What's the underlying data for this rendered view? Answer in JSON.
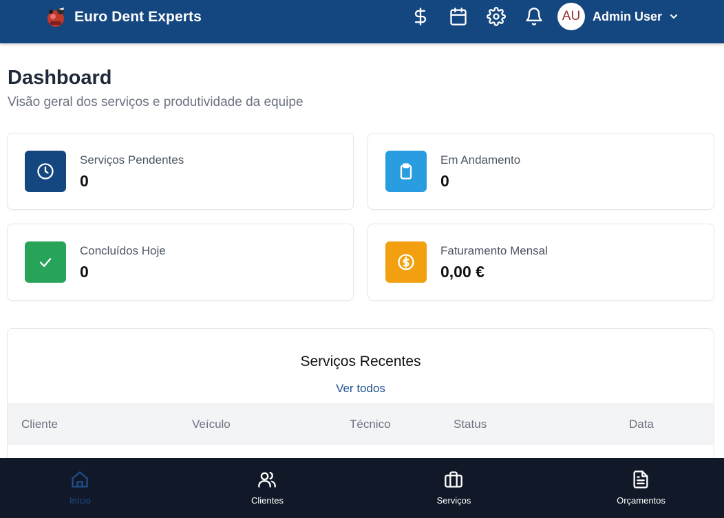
{
  "colors": {
    "header_bg": "#14467f",
    "nav_bg": "#111827",
    "active_nav": "#1e4f8f",
    "card_pending": "#14467f",
    "card_progress": "#2a9de0",
    "card_done": "#27a35a",
    "card_revenue": "#f2a00f"
  },
  "header": {
    "brand": "Euro Dent Experts",
    "icons": [
      "dollar-icon",
      "calendar-icon",
      "gear-icon",
      "bell-icon"
    ],
    "user": {
      "initials": "AU",
      "name": "Admin User"
    }
  },
  "page": {
    "title": "Dashboard",
    "subtitle": "Visão geral dos serviços e produtividade da equipe"
  },
  "stats": [
    {
      "label": "Serviços Pendentes",
      "value": "0",
      "icon": "clock-icon"
    },
    {
      "label": "Em Andamento",
      "value": "0",
      "icon": "clipboard-icon"
    },
    {
      "label": "Concluídos Hoje",
      "value": "0",
      "icon": "check-icon"
    },
    {
      "label": "Faturamento Mensal",
      "value": "0,00 €",
      "icon": "coin-icon"
    }
  ],
  "recent": {
    "title": "Serviços Recentes",
    "link": "Ver todos",
    "columns": [
      "Cliente",
      "Veículo",
      "Técnico",
      "Status",
      "Data"
    ]
  },
  "bottom_nav": [
    {
      "label": "Início",
      "icon": "home-icon",
      "active": true
    },
    {
      "label": "Clientes",
      "icon": "users-icon",
      "active": false
    },
    {
      "label": "Serviços",
      "icon": "briefcase-icon",
      "active": false
    },
    {
      "label": "Orçamentos",
      "icon": "document-icon",
      "active": false
    }
  ]
}
